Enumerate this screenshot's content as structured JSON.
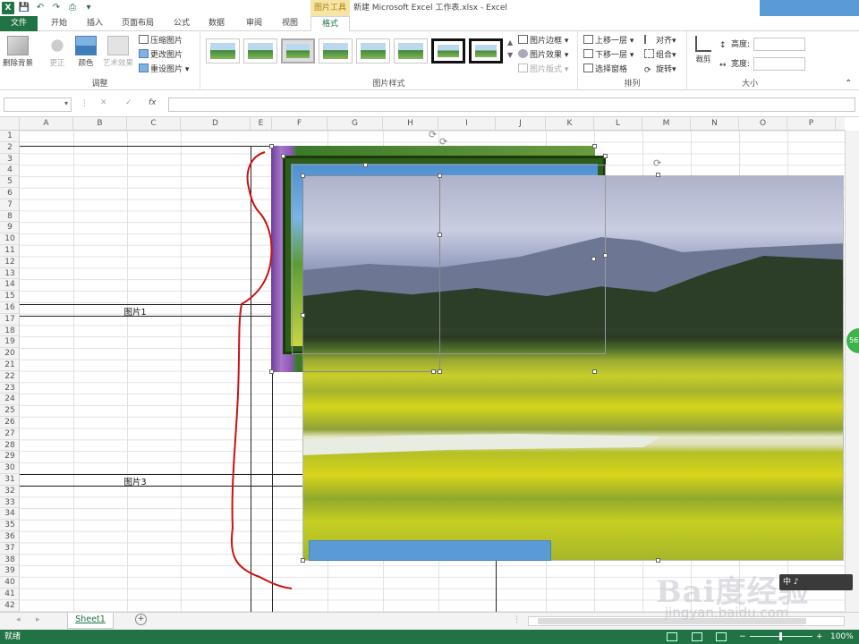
{
  "window": {
    "title": "新建 Microsoft Excel 工作表.xlsx - Excel",
    "context_tab_group": "图片工具"
  },
  "tabs": [
    "文件",
    "开始",
    "插入",
    "页面布局",
    "公式",
    "数据",
    "审阅",
    "视图",
    "格式"
  ],
  "ribbon": {
    "adjust": {
      "remove_bg": "删除背景",
      "correct": "更正",
      "color": "颜色",
      "artistic": "艺术效果",
      "compress": "压缩图片",
      "change": "更改图片",
      "reset": "重设图片",
      "label": "调整"
    },
    "styles": {
      "label": "图片样式",
      "border": "图片边框",
      "effects": "图片效果",
      "layout": "图片版式"
    },
    "arrange": {
      "label": "排列",
      "bring_forward": "上移一层",
      "send_backward": "下移一层",
      "selection_pane": "选择窗格",
      "align": "对齐",
      "group": "组合",
      "rotate": "旋转"
    },
    "size": {
      "label": "大小",
      "crop": "裁剪",
      "height_label": "高度:",
      "width_label": "宽度:"
    }
  },
  "formula_bar": {
    "fx": "fx"
  },
  "columns": [
    "A",
    "B",
    "C",
    "D",
    "E",
    "F",
    "G",
    "H",
    "I",
    "J",
    "K",
    "L",
    "M",
    "N",
    "O",
    "P"
  ],
  "rows": [
    "1",
    "2",
    "3",
    "4",
    "5",
    "6",
    "7",
    "8",
    "9",
    "10",
    "11",
    "12",
    "13",
    "14",
    "15",
    "16",
    "17",
    "18",
    "19",
    "20",
    "21",
    "22",
    "23",
    "24",
    "25",
    "26",
    "27",
    "28",
    "29",
    "30",
    "31",
    "32",
    "33",
    "34",
    "35",
    "36",
    "37",
    "38",
    "39",
    "40",
    "41",
    "42"
  ],
  "cells": {
    "pic1_label": "图片1",
    "pic3_label": "图片3"
  },
  "sheet_tab": "Sheet1",
  "status": {
    "ready": "就绪",
    "zoom": "100%"
  },
  "scroll_badge": "56",
  "watermark": {
    "brand": "Bai度经验",
    "url": "jingyan.baidu.com",
    "badge": "中 ♪"
  },
  "colors": {
    "excel_green": "#217346",
    "accent_blue": "#5b9bd5",
    "annotation_red": "#cc1111"
  }
}
